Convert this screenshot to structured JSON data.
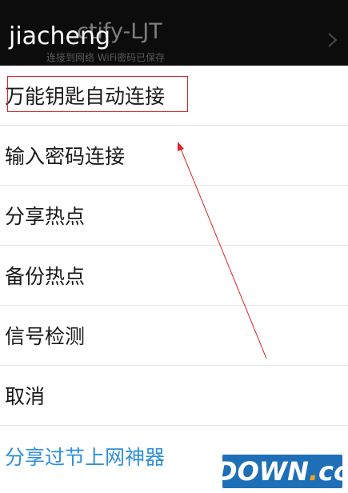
{
  "background_window": {
    "title": "ctify-LJT",
    "subtitle": "连接到网络   WiFi密码已保存"
  },
  "dialog": {
    "title": "jiacheng",
    "items": [
      {
        "label": "万能钥匙自动连接"
      },
      {
        "label": "输入密码连接"
      },
      {
        "label": "分享热点"
      },
      {
        "label": "备份热点"
      },
      {
        "label": "信号检测"
      },
      {
        "label": "取消"
      },
      {
        "label": "分享过节上网神器"
      }
    ]
  },
  "watermark": {
    "text_main": "DOWN",
    "text_dot": ".",
    "text_tld": "cc"
  },
  "colors": {
    "header_bg": "#0c0c0c",
    "share_link": "#2f8fd8",
    "annotation": "#d9262c"
  }
}
